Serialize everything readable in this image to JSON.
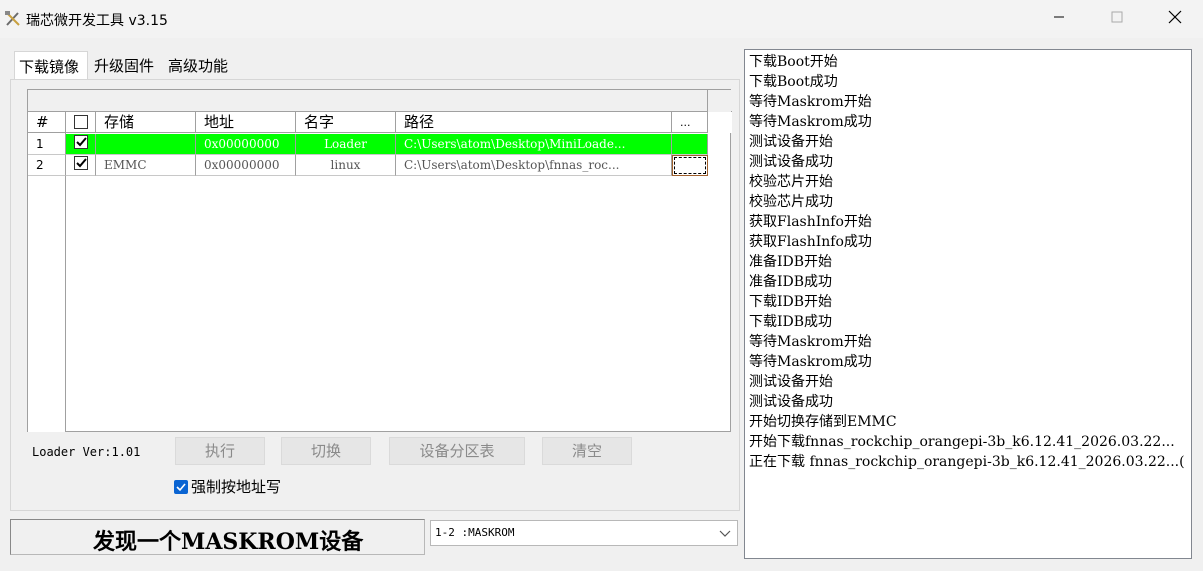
{
  "window": {
    "title": "瑞芯微开发工具 v3.15"
  },
  "tabs": [
    {
      "label": "下载镜像"
    },
    {
      "label": "升级固件"
    },
    {
      "label": "高级功能"
    }
  ],
  "grid": {
    "headers": [
      "#",
      "存储",
      "地址",
      "名字",
      "路径",
      "..."
    ],
    "rows": [
      {
        "index": "1",
        "checked": true,
        "storage": "",
        "address": "0x00000000",
        "name": "Loader",
        "path": "C:\\Users\\atom\\Desktop\\MiniLoade..."
      },
      {
        "index": "2",
        "checked": true,
        "storage": "EMMC",
        "address": "0x00000000",
        "name": "linux",
        "path": "C:\\Users\\atom\\Desktop\\fnnas_roc..."
      }
    ]
  },
  "loader_version": "Loader Ver:1.01",
  "buttons": {
    "execute": "执行",
    "switch": "切换",
    "partition_table": "设备分区表",
    "clear": "清空"
  },
  "force_write": {
    "label": "强制按地址写",
    "checked": true
  },
  "status": "发现一个MASKROM设备",
  "device_select": {
    "value": "1-2 :MASKROM"
  },
  "log": [
    "下载Boot开始",
    "下载Boot成功",
    "等待Maskrom开始",
    "等待Maskrom成功",
    "测试设备开始",
    "测试设备成功",
    "校验芯片开始",
    "校验芯片成功",
    "获取FlashInfo开始",
    "获取FlashInfo成功",
    "准备IDB开始",
    "准备IDB成功",
    "下载IDB开始",
    "下载IDB成功",
    "等待Maskrom开始",
    "等待Maskrom成功",
    "测试设备开始",
    "测试设备成功",
    "开始切换存储到EMMC",
    "开始下载fnnas_rockchip_orangepi-3b_k6.12.41_2026.03.22...",
    "正在下载 fnnas_rockchip_orangepi-3b_k6.12.41_2026.03.22...("
  ],
  "colors": {
    "row_selected": "#00ff00",
    "checkbox_accent": "#0a64d2"
  },
  "icons": {
    "app": "tools-icon",
    "minimize": "minimize-icon",
    "maximize": "maximize-icon",
    "close": "close-icon",
    "dropdown": "chevron-down-icon"
  }
}
